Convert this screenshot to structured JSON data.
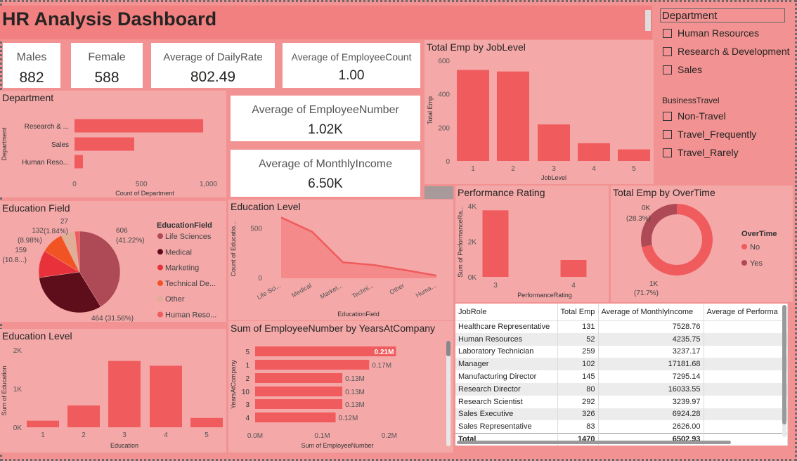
{
  "title": "HR Analysis Dashboard",
  "cards": {
    "males": {
      "label": "Males",
      "value": "882"
    },
    "female": {
      "label": "Female",
      "value": "588"
    },
    "daily_rate": {
      "label": "Average of DailyRate",
      "value": "802.49"
    },
    "employee_count": {
      "label": "Average of EmployeeCount",
      "value": "1.00"
    },
    "employee_number": {
      "label": "Average of EmployeeNumber",
      "value": "1.02K"
    },
    "monthly_income": {
      "label": "Average of MonthlyIncome",
      "value": "6.50K"
    }
  },
  "slicers": {
    "department": {
      "title": "Department",
      "items": [
        "Human Resources",
        "Research & Development",
        "Sales"
      ]
    },
    "business_travel": {
      "title": "BusinessTravel",
      "items": [
        "Non-Travel",
        "Travel_Frequently",
        "Travel_Rarely"
      ]
    }
  },
  "colors": {
    "bar": "#f05c5e",
    "bg": "#f4a8a8"
  },
  "chart_data": [
    {
      "id": "department",
      "type": "bar",
      "orientation": "horizontal",
      "title": "Department",
      "categories": [
        "Research & ...",
        "Sales",
        "Human Reso..."
      ],
      "values": [
        961,
        446,
        63
      ],
      "xlabel": "Count of Department",
      "ylabel": "Department",
      "xticks": [
        "0",
        "500",
        "1,000"
      ],
      "xlim": [
        0,
        1050
      ]
    },
    {
      "id": "joblevel",
      "type": "bar",
      "title": "Total Emp by JobLevel",
      "categories": [
        "1",
        "2",
        "3",
        "4",
        "5"
      ],
      "values": [
        543,
        534,
        218,
        106,
        69
      ],
      "xlabel": "JobLevel",
      "ylabel": "Total Emp",
      "yticks": [
        "0",
        "200",
        "400",
        "600"
      ],
      "ylim": [
        0,
        600
      ]
    },
    {
      "id": "education_field",
      "type": "pie",
      "title": "Education Field",
      "legend_title": "EducationField",
      "slices": [
        {
          "name": "Life Sciences",
          "value": 606,
          "label": "606",
          "pct": "(41.22%)",
          "color": "#ae4a55"
        },
        {
          "name": "Medical",
          "value": 464,
          "label": "464 (31.56%)",
          "pct": "",
          "color": "#5e0e1a"
        },
        {
          "name": "Marketing",
          "value": 159,
          "label": "159",
          "pct": "(10.8...)",
          "color": "#e8313a"
        },
        {
          "name": "Technical De...",
          "value": 132,
          "label": "132",
          "pct": "(8.98%)",
          "color": "#f25323"
        },
        {
          "name": "Other",
          "value": 82,
          "label": "(1.84%)",
          "pct": "",
          "color": "#e0ae96"
        },
        {
          "name": "Human Reso...",
          "value": 27,
          "label": "27",
          "pct": "",
          "color": "#f05c5e"
        }
      ]
    },
    {
      "id": "education_level_area",
      "type": "area",
      "title": "Education Level",
      "categories": [
        "Life Sci...",
        "Medical",
        "Market...",
        "Techni...",
        "Other",
        "Huma..."
      ],
      "values": [
        606,
        464,
        159,
        132,
        82,
        27
      ],
      "xlabel": "EducationField",
      "ylabel": "Count of Educatio...",
      "yticks": [
        "0",
        "500"
      ],
      "ylim": [
        0,
        700
      ]
    },
    {
      "id": "performance",
      "type": "bar",
      "title": "Performance Rating",
      "categories": [
        "3",
        "4"
      ],
      "values": [
        3750,
        950
      ],
      "xlabel": "PerformanceRating",
      "ylabel": "Sum of PerformanceRa...",
      "yticks": [
        "0K",
        "2K",
        "4K"
      ],
      "ylim": [
        0,
        4000
      ]
    },
    {
      "id": "overtime",
      "type": "pie",
      "title": "Total Emp by OverTime",
      "legend_title": "OverTime",
      "slices": [
        {
          "name": "No",
          "value": 1054,
          "label": "1K",
          "pct": "(71.7%)",
          "color": "#f05c5e"
        },
        {
          "name": "Yes",
          "value": 416,
          "label": "0K",
          "pct": "(28.3%)",
          "color": "#ae4a55"
        }
      ]
    },
    {
      "id": "education_level_bar",
      "type": "bar",
      "title": "Education Level",
      "categories": [
        "1",
        "2",
        "3",
        "4",
        "5"
      ],
      "values": [
        170,
        564,
        1716,
        1592,
        240
      ],
      "xlabel": "Education",
      "ylabel": "Sum of Education",
      "yticks": [
        "0K",
        "1K",
        "2K"
      ],
      "ylim": [
        0,
        2000
      ]
    },
    {
      "id": "years_at_company",
      "type": "bar",
      "orientation": "horizontal",
      "title": "Sum of EmployeeNumber by YearsAtCompany",
      "categories": [
        "5",
        "1",
        "2",
        "10",
        "3",
        "4"
      ],
      "values": [
        0.21,
        0.17,
        0.13,
        0.13,
        0.13,
        0.12
      ],
      "labels": [
        "0.21M",
        "0.17M",
        "0.13M",
        "0.13M",
        "0.13M",
        "0.12M"
      ],
      "xlabel": "Sum of EmployeeNumber",
      "ylabel": "YearsAtCompany",
      "xticks": [
        "0.0M",
        "0.1M",
        "0.2M"
      ],
      "xlim": [
        0,
        0.22
      ]
    },
    {
      "id": "jobrole_table",
      "type": "table",
      "columns": [
        "JobRole",
        "Total Emp",
        "Average of MonthlyIncome",
        "Average of Performa"
      ],
      "rows": [
        [
          "Healthcare Representative",
          "131",
          "7528.76"
        ],
        [
          "Human Resources",
          "52",
          "4235.75"
        ],
        [
          "Laboratory Technician",
          "259",
          "3237.17"
        ],
        [
          "Manager",
          "102",
          "17181.68"
        ],
        [
          "Manufacturing Director",
          "145",
          "7295.14"
        ],
        [
          "Research Director",
          "80",
          "16033.55"
        ],
        [
          "Research Scientist",
          "292",
          "3239.97"
        ],
        [
          "Sales Executive",
          "326",
          "6924.28"
        ],
        [
          "Sales Representative",
          "83",
          "2626.00"
        ]
      ],
      "total": [
        "Total",
        "1470",
        "6502.93"
      ]
    }
  ]
}
